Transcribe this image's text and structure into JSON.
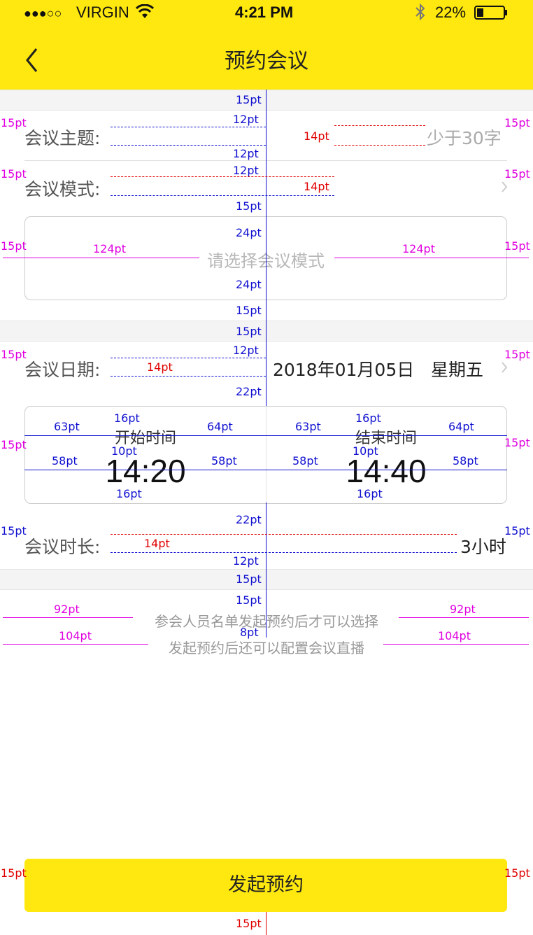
{
  "status_bar": {
    "signal": "●●●○○",
    "carrier": "VIRGIN",
    "time": "4:21 PM",
    "battery": "22%",
    "icons": [
      "wifi-icon",
      "bluetooth-icon",
      "battery-icon"
    ]
  },
  "nav": {
    "title": "预约会议",
    "back_icon": "chevron-left-icon"
  },
  "form": {
    "topic_label": "会议主题:",
    "topic_placeholder": "少于30字",
    "mode_label": "会议模式:",
    "mode_placeholder": "请选择会议模式",
    "date_label": "会议日期:",
    "date_value": "2018年01月05日",
    "weekday": "星期五",
    "start_label": "开始时间",
    "start_time": "14:20",
    "end_label": "结束时间",
    "end_time": "14:40",
    "duration_label": "会议时长:",
    "duration_value": "3小时"
  },
  "notes": {
    "line1": "参会人员名单发起预约后才可以选择",
    "line2": "发起预约后还可以配置会议直播"
  },
  "submit_label": "发起预约",
  "annotations": {
    "pt15": "15pt",
    "pt12": "12pt",
    "pt14": "14pt",
    "pt24": "24pt",
    "pt22": "22pt",
    "pt124": "124pt",
    "pt16": "16pt",
    "pt10": "10pt",
    "pt63": "63pt",
    "pt64": "64pt",
    "pt58": "58pt",
    "pt92": "92pt",
    "pt104": "104pt",
    "pt8": "8pt"
  },
  "colors": {
    "accent": "#FFE80F",
    "annotation_blue": "#1010d0",
    "annotation_red": "#e00000",
    "annotation_magenta": "#e000e0"
  }
}
